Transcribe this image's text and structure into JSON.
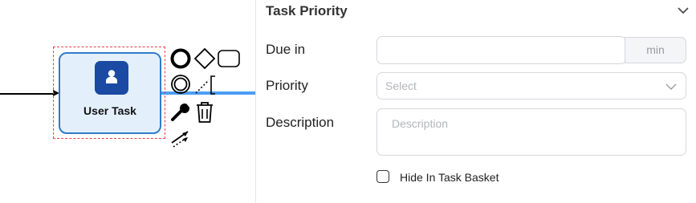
{
  "diagram": {
    "task": {
      "label": "User Task",
      "icon": "user-icon"
    },
    "palette_icons": [
      "end-event-icon",
      "gateway-icon",
      "task-icon",
      "intermediate-event-icon",
      "text-annotation-icon",
      "wrench-icon",
      "trash-icon",
      "connect-icon"
    ],
    "colors": {
      "task_fill": "#e3f0fc",
      "task_border": "#2f7cc9",
      "task_icon_bg": "#1a4aa1",
      "selection_outline": "#e8414b",
      "connection": "#4b9ef5"
    }
  },
  "panel": {
    "section_title": "Task Priority",
    "due_in": {
      "label": "Due in",
      "value": "",
      "placeholder": "",
      "suffix": "min"
    },
    "priority": {
      "label": "Priority",
      "placeholder": "Select"
    },
    "description": {
      "label": "Description",
      "value": "",
      "placeholder": "Description"
    },
    "hide_in_task_basket": {
      "label": "Hide In Task Basket",
      "checked": false
    }
  }
}
